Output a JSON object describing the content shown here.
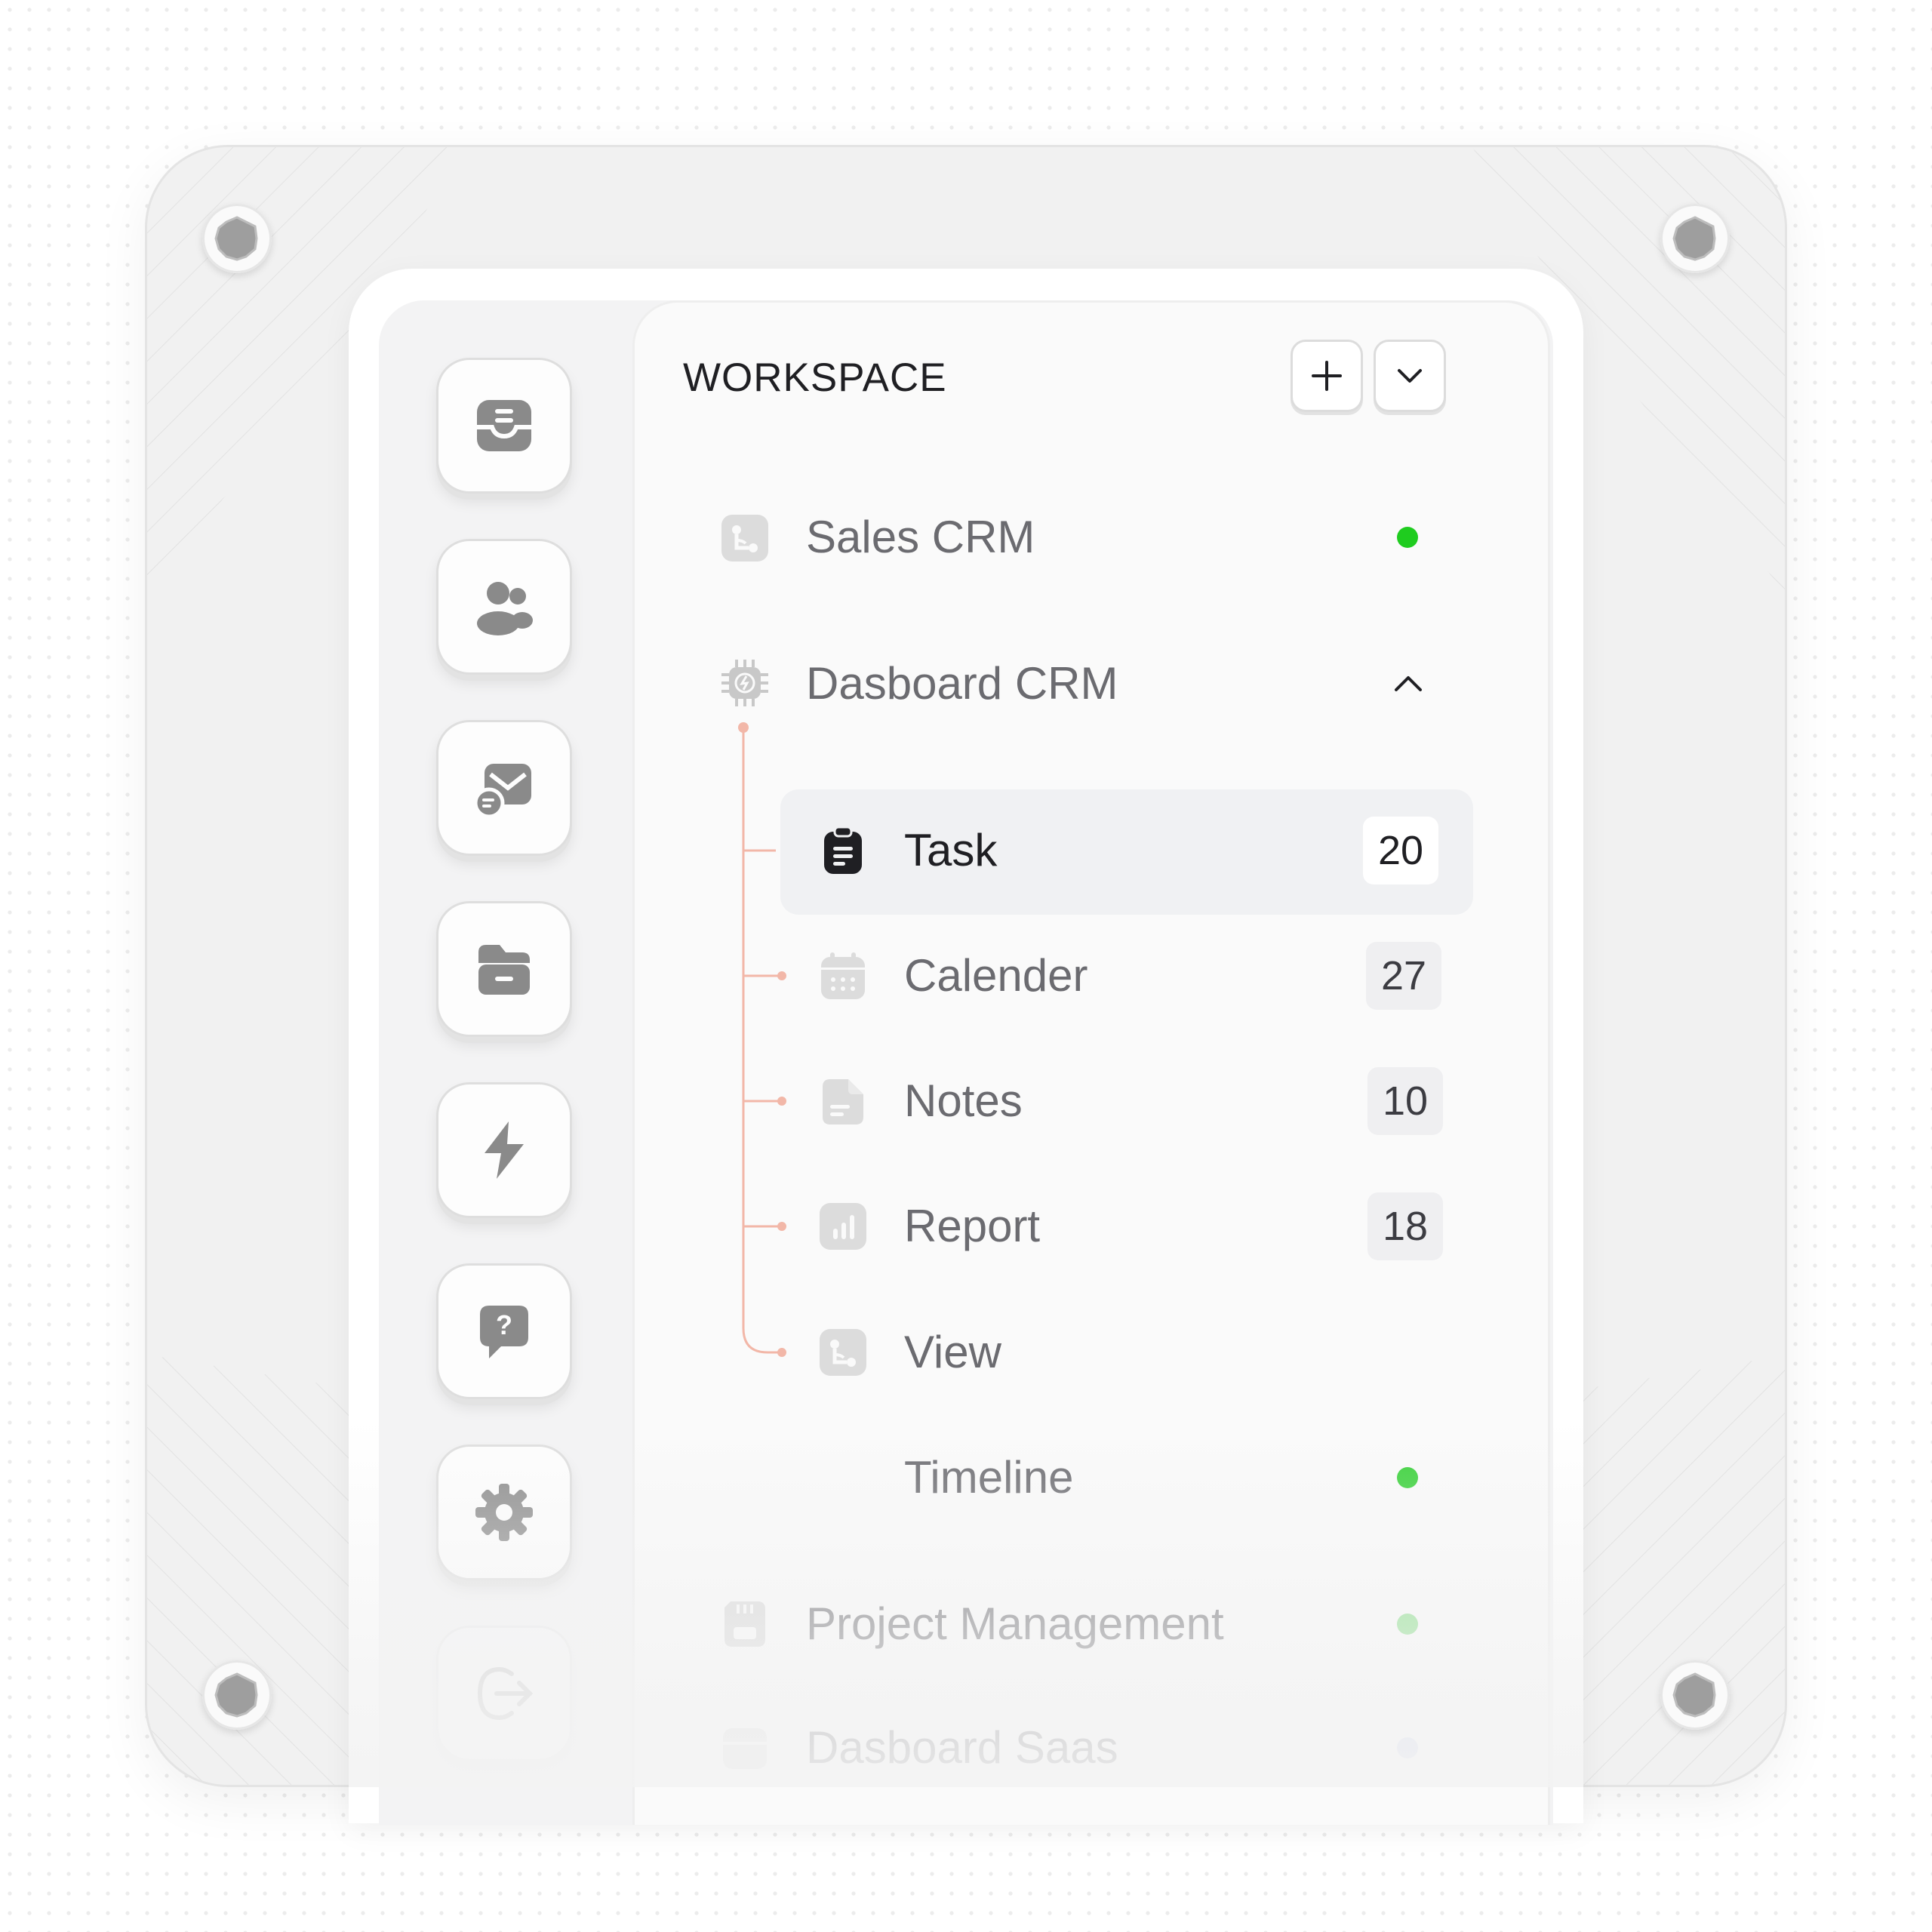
{
  "colors": {
    "green": "#22cc22",
    "tree_line": "#f2b7a8",
    "icon_gray": "#8a8a8a",
    "text_dark": "#1f1f23",
    "text_gray": "#6b6b70"
  },
  "rail": {
    "items": [
      {
        "icon": "inbox-tray-icon"
      },
      {
        "icon": "users-icon"
      },
      {
        "icon": "mail-chat-icon"
      },
      {
        "icon": "folder-icon"
      },
      {
        "icon": "lightning-icon"
      },
      {
        "icon": "help-chat-icon"
      },
      {
        "icon": "gear-icon"
      },
      {
        "icon": "logout-icon"
      }
    ]
  },
  "workspace": {
    "title": "WORKSPACE",
    "add_button_icon": "plus-icon",
    "dropdown_button_icon": "chevron-down-icon",
    "sales_crm": {
      "label": "Sales CRM",
      "status": "online"
    },
    "dashboard_crm": {
      "label": "Dasboard CRM",
      "expanded": true,
      "children": [
        {
          "label": "Task",
          "count": "20",
          "icon": "clipboard-icon",
          "active": true
        },
        {
          "label": "Calender",
          "count": "27",
          "icon": "calendar-icon"
        },
        {
          "label": "Notes",
          "count": "10",
          "icon": "note-icon"
        },
        {
          "label": "Report",
          "count": "18",
          "icon": "chart-icon"
        },
        {
          "label": "View",
          "icon": "flow-icon"
        }
      ]
    },
    "timeline": {
      "label": "Timeline",
      "status": "online"
    },
    "project_management": {
      "label": "Project Management",
      "status": "online"
    },
    "dashboard_saas": {
      "label": "Dasboard Saas",
      "status": "idle"
    }
  }
}
